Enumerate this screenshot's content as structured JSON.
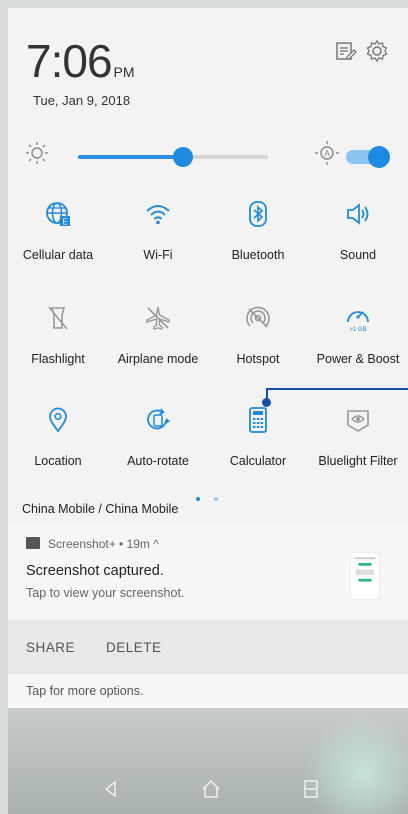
{
  "status": {
    "time": "7:06",
    "ampm": "PM",
    "date": "Tue, Jan 9, 2018"
  },
  "header_icons": [
    "edit-icon",
    "gear-icon"
  ],
  "brightness": {
    "level": 0.55,
    "auto_on": true,
    "accent": "#1f8ae2"
  },
  "tiles": [
    {
      "label": "Cellular data",
      "icon": "globe-icon",
      "active": true
    },
    {
      "label": "Wi-Fi",
      "icon": "wifi-icon",
      "active": true
    },
    {
      "label": "Bluetooth",
      "icon": "bluetooth-icon",
      "active": true
    },
    {
      "label": "Sound",
      "icon": "speaker-icon",
      "active": true
    },
    {
      "label": "Flashlight",
      "icon": "flashlight-icon",
      "active": false
    },
    {
      "label": "Airplane mode",
      "icon": "airplane-icon",
      "active": false
    },
    {
      "label": "Hotspot",
      "icon": "hotspot-icon",
      "active": false
    },
    {
      "label": "Power & Boost",
      "icon": "speedometer-icon",
      "active": true,
      "badge": ">1 GB"
    },
    {
      "label": "Location",
      "icon": "location-icon",
      "active": true
    },
    {
      "label": "Auto-rotate",
      "icon": "rotate-icon",
      "active": true
    },
    {
      "label": "Calculator",
      "icon": "calculator-icon",
      "active": true
    },
    {
      "label": "Bluelight Filter",
      "icon": "eye-icon",
      "active": false
    }
  ],
  "page_indicator": {
    "count": 2,
    "current": 0
  },
  "carrier": "China Mobile / China Mobile",
  "notification": {
    "app_line": "Screenshot+ • 19m ^",
    "title": "Screenshot captured.",
    "subtitle": "Tap to view your screenshot."
  },
  "actions": {
    "share": "SHARE",
    "delete": "DELETE"
  },
  "more_options": "Tap for more options."
}
